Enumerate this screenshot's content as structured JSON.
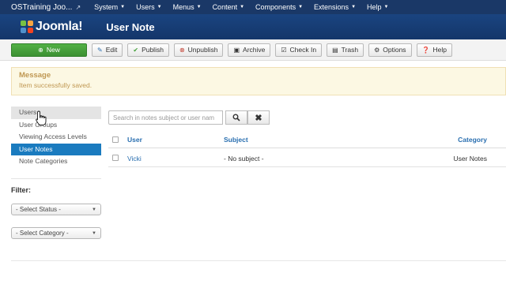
{
  "topnav": {
    "site_name": "OSTraining Joo...",
    "menus": [
      "System",
      "Users",
      "Menus",
      "Content",
      "Components",
      "Extensions",
      "Help"
    ]
  },
  "header": {
    "logo_text": "Joomla!",
    "title": "User Note"
  },
  "toolbar": {
    "new": "New",
    "edit": "Edit",
    "publish": "Publish",
    "unpublish": "Unpublish",
    "archive": "Archive",
    "checkin": "Check In",
    "trash": "Trash",
    "options": "Options",
    "help": "Help"
  },
  "message": {
    "heading": "Message",
    "text": "Item successfully saved."
  },
  "sidebar": {
    "items": [
      {
        "label": "Users"
      },
      {
        "label": "User Groups"
      },
      {
        "label": "Viewing Access Levels"
      },
      {
        "label": "User Notes"
      },
      {
        "label": "Note Categories"
      }
    ],
    "filter_label": "Filter:",
    "status_select": "- Select Status -",
    "category_select": "- Select Category -"
  },
  "search": {
    "placeholder": "Search in notes subject or user nam"
  },
  "table": {
    "headers": {
      "user": "User",
      "subject": "Subject",
      "category": "Category"
    },
    "rows": [
      {
        "user": "Vicki",
        "subject": "- No subject -",
        "category": "User Notes"
      }
    ]
  },
  "colors": {
    "navbar": "#1a3867",
    "header": "#1a4480",
    "new_button": "#46a23c",
    "active_sidebar": "#1a7bbf",
    "message_bg": "#fcf8e3",
    "message_text": "#c09853",
    "link": "#2a6fb0"
  }
}
